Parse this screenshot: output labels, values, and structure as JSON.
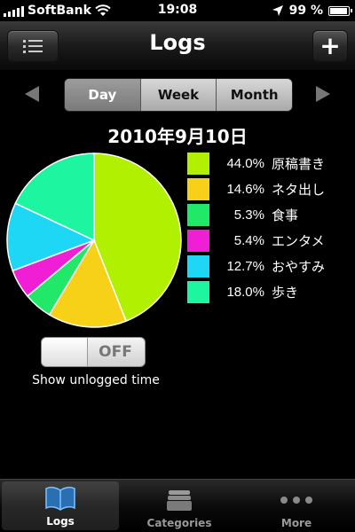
{
  "status": {
    "carrier": "SoftBank",
    "time": "19:08",
    "battery": "99 %",
    "battery_level": 0.99
  },
  "nav": {
    "title": "Logs",
    "add_label": "+"
  },
  "segments": [
    {
      "label": "Day",
      "active": true
    },
    {
      "label": "Week",
      "active": false
    },
    {
      "label": "Month",
      "active": false
    }
  ],
  "date_title": "2010年9月10日",
  "chart_data": {
    "type": "pie",
    "slices": [
      {
        "name": "原稿書き",
        "percent": 44.0,
        "label": "44.0%",
        "color": "#b0f000"
      },
      {
        "name": "ネタ出し",
        "percent": 14.6,
        "label": "14.6%",
        "color": "#f7d117"
      },
      {
        "name": "食事",
        "percent": 5.3,
        "label": "5.3%",
        "color": "#22e86a"
      },
      {
        "name": "エンタメ",
        "percent": 5.4,
        "label": "5.4%",
        "color": "#f01ed4"
      },
      {
        "name": "おやすみ",
        "percent": 12.7,
        "label": "12.7%",
        "color": "#1ed7f4"
      },
      {
        "name": "歩き",
        "percent": 18.0,
        "label": "18.0%",
        "color": "#1ef5a0"
      }
    ]
  },
  "toggle": {
    "state_label": "OFF",
    "caption": "Show unlogged time"
  },
  "tabs": [
    {
      "label": "Logs",
      "icon": "book-icon",
      "active": true
    },
    {
      "label": "Categories",
      "icon": "stack-icon",
      "active": false
    },
    {
      "label": "More",
      "icon": "more-dots-icon",
      "active": false
    }
  ]
}
